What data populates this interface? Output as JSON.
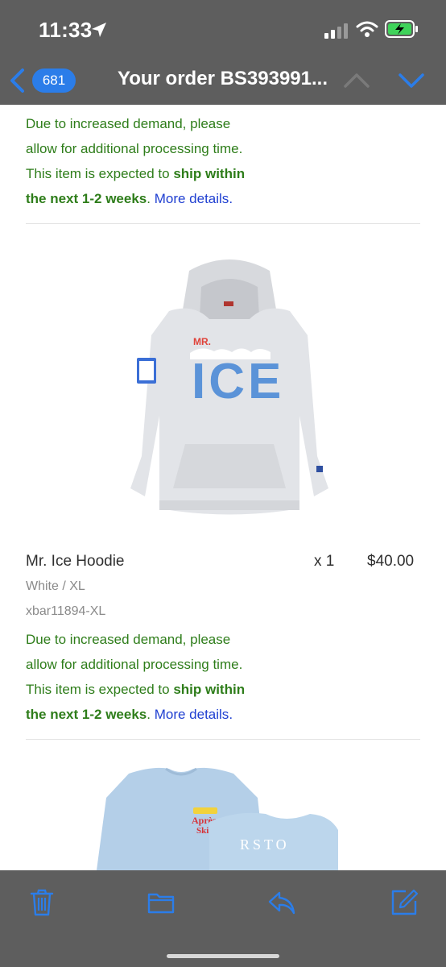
{
  "status_bar": {
    "time": "11:33",
    "icons": [
      "location-arrow-icon",
      "cellular-signal-icon",
      "wifi-icon",
      "battery-charging-icon"
    ]
  },
  "nav": {
    "back_icon": "chevron-left-icon",
    "unread_count": "681",
    "title": "Your order BS393991...",
    "prev_icon": "chevron-up-icon",
    "next_icon": "chevron-down-icon"
  },
  "notice_top": {
    "line1": "Due to increased demand, please",
    "line2": "allow for additional processing time.",
    "line3_prefix": "This item is expected to ",
    "line3_bold": "ship within",
    "line4_bold": "the next 1-2 weeks",
    "line4_suffix": ". ",
    "more_link": "More details",
    "after_link": "."
  },
  "item": {
    "image_icon": "hoodie-product-image",
    "name": "Mr. Ice Hoodie",
    "quantity": "x 1",
    "price": "$40.00",
    "variant": "White / XL",
    "sku": "xbar11894-XL",
    "notice": {
      "line1": "Due to increased demand, please",
      "line2": "allow for additional processing time.",
      "line3_prefix": "This item is expected to ",
      "line3_bold": "ship within",
      "line4_bold": "the next 1-2 weeks",
      "line4_suffix": ". ",
      "more_link": "More details",
      "after_link": "."
    }
  },
  "item2": {
    "image_icon": "sweatshirt-product-image"
  },
  "toolbar": {
    "icons": [
      "trash-icon",
      "folder-icon",
      "reply-icon",
      "compose-icon"
    ]
  },
  "colors": {
    "chrome": "#5e5e5e",
    "accent": "#2b7de9",
    "notice_green": "#2e7d1a",
    "link_blue": "#1f3fd1"
  }
}
